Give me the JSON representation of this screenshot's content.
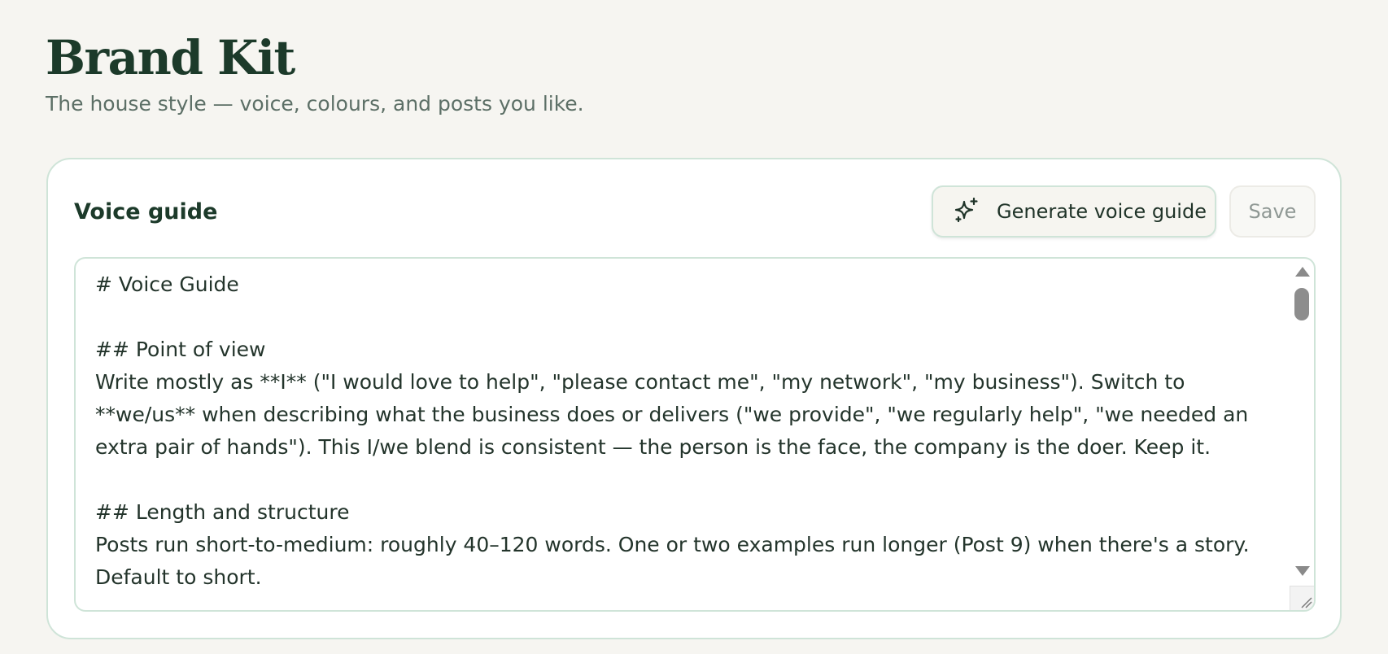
{
  "header": {
    "title": "Brand Kit",
    "subtitle": "The house style — voice, colours, and posts you like."
  },
  "voice_card": {
    "title": "Voice guide",
    "generate_label": "Generate voice guide",
    "generate_icon": "sparkles-icon",
    "save_label": "Save",
    "content": "# Voice Guide\n\n## Point of view\nWrite mostly as **I** (\"I would love to help\", \"please contact me\", \"my network\", \"my business\"). Switch to **we/us** when describing what the business does or delivers (\"we provide\", \"we regularly help\", \"we needed an extra pair of hands\"). This I/we blend is consistent — the person is the face, the company is the doer. Keep it.\n\n## Length and structure\nPosts run short-to-medium: roughly 40–120 words. One or two examples run longer (Post 9) when there's a story. Default to short."
  }
}
